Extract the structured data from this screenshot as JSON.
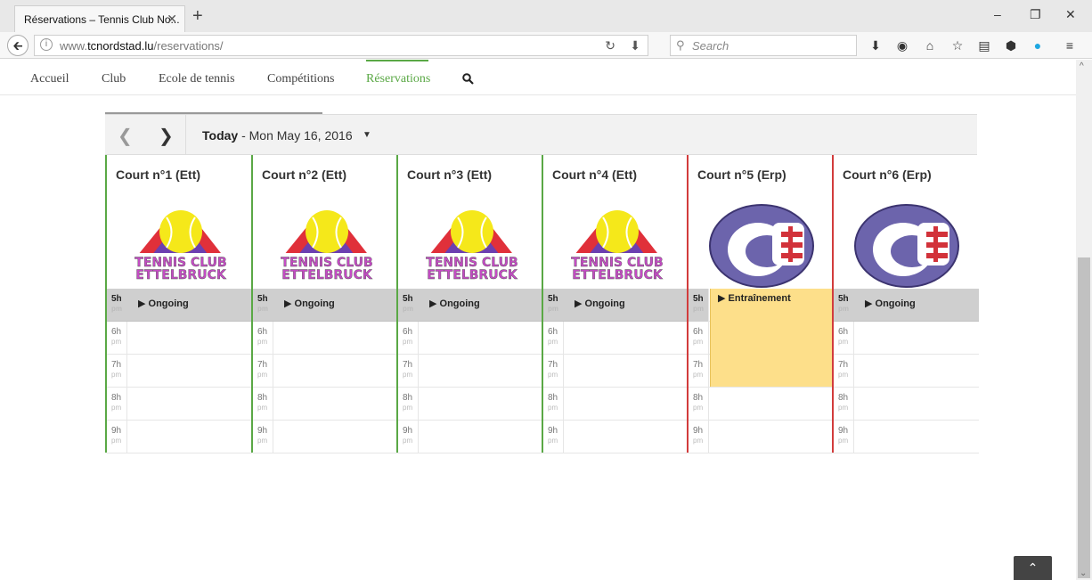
{
  "browser": {
    "tab_title": "Réservations – Tennis Club No...",
    "tab_close": "✕",
    "new_tab": "+",
    "url_prefix": "www.",
    "url_domain": "tcnordstad.lu",
    "url_path": "/reservations/",
    "search_placeholder": "Search"
  },
  "site_nav": {
    "items": [
      "Accueil",
      "Club",
      "Ecole de tennis",
      "Compétitions",
      "Réservations"
    ],
    "active_index": 4,
    "accent": "#5aa845"
  },
  "calendar": {
    "today_label": "Today",
    "date_text": " - Mon May 16, 2016",
    "hours": [
      {
        "h": "5h",
        "ampm": "pm"
      },
      {
        "h": "6h",
        "ampm": "pm"
      },
      {
        "h": "7h",
        "ampm": "pm"
      },
      {
        "h": "8h",
        "ampm": "pm"
      },
      {
        "h": "9h",
        "ampm": "pm"
      }
    ],
    "courts": [
      {
        "name": "Court n°1 (Ett)",
        "logo": "tennis-club-ettelbruck-logo",
        "logo_text": [
          "TENNIS CLUB",
          "ETTELBRUCK"
        ],
        "border": "#5aa845",
        "event": "Ongoing",
        "event_type": "ongoing"
      },
      {
        "name": "Court n°2 (Ett)",
        "logo": "tennis-club-ettelbruck-logo",
        "logo_text": [
          "TENNIS CLUB",
          "ETTELBRUCK"
        ],
        "border": "#5aa845",
        "event": "Ongoing",
        "event_type": "ongoing"
      },
      {
        "name": "Court n°3 (Ett)",
        "logo": "tennis-club-ettelbruck-logo",
        "logo_text": [
          "TENNIS CLUB",
          "ETTELBRUCK"
        ],
        "border": "#5aa845",
        "event": "Ongoing",
        "event_type": "ongoing"
      },
      {
        "name": "Court n°4 (Ett)",
        "logo": "tennis-club-ettelbruck-logo",
        "logo_text": [
          "TENNIS CLUB",
          "ETTELBRUCK"
        ],
        "border": "#5aa845",
        "event": "Ongoing",
        "event_type": "ongoing"
      },
      {
        "name": "Court n°5 (Erp)",
        "logo": "tc-erpeldange-logo",
        "border": "#d23c3c",
        "event": "Entraînement",
        "event_type": "booking"
      },
      {
        "name": "Court n°6 (Erp)",
        "logo": "tc-erpeldange-logo",
        "border": "#d23c3c",
        "event": "Ongoing",
        "event_type": "ongoing"
      }
    ],
    "booking_color": "#fddf8a"
  }
}
